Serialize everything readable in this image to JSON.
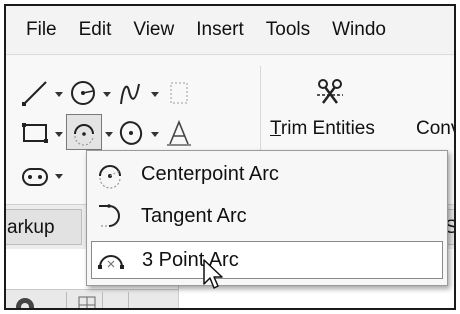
{
  "menubar": {
    "items": [
      {
        "label": "File"
      },
      {
        "label": "Edit"
      },
      {
        "label": "View"
      },
      {
        "label": "Insert"
      },
      {
        "label": "Tools"
      },
      {
        "label": "Windo"
      }
    ]
  },
  "toolbar": {
    "trim_label_first": "T",
    "trim_label_rest": "rim Entities",
    "convert_label": "Conv"
  },
  "tabs": {
    "markup_label": "arkup",
    "right_label": "S"
  },
  "arc_menu": {
    "items": [
      {
        "label": "Centerpoint Arc",
        "icon": "centerpoint-arc-icon",
        "highlighted": false
      },
      {
        "label": "Tangent Arc",
        "icon": "tangent-arc-icon",
        "highlighted": false
      },
      {
        "label": "3 Point Arc",
        "icon": "3-point-arc-icon",
        "highlighted": true
      }
    ]
  },
  "colors": {
    "menu_bg": "#f3f3f3",
    "dropdown_bg": "#f7f7f7",
    "highlight_bg": "#ffffff",
    "icon_stroke": "#222222"
  }
}
